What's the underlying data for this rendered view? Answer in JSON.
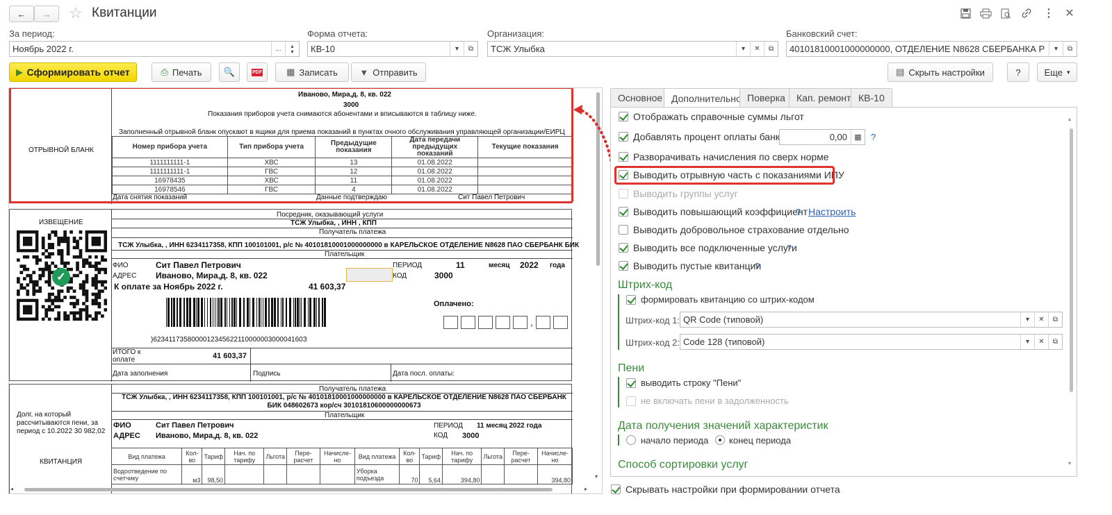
{
  "window": {
    "title": "Квитанции"
  },
  "filters": {
    "period_label": "За период:",
    "period_value": "Ноябрь 2022 г.",
    "period_dots": "...",
    "form_label": "Форма отчета:",
    "form_value": "КВ-10",
    "org_label": "Организация:",
    "org_value": "ТСЖ Улыбка",
    "bank_label": "Банковский счет:",
    "bank_value": "40101810001000000000, ОТДЕЛЕНИЕ N8628 СБЕРБАНКА Р"
  },
  "toolbar": {
    "generate": "Сформировать отчет",
    "print": "Печать",
    "save": "Записать",
    "send": "Отправить",
    "hide_settings": "Скрыть настройки",
    "help": "?",
    "more": "Еще"
  },
  "tabs": [
    "Основное",
    "Дополнительно",
    "Поверка",
    "Кап. ремонт",
    "КВ-10"
  ],
  "settings": {
    "opt1": "Отображать справочные суммы льгот",
    "opt2": "Добавлять процент оплаты банку",
    "opt2_value": "0,00",
    "opt3": "Разворачивать начисления по сверх норме",
    "opt4": "Выводить отрывную часть с показаниями ИПУ",
    "opt5": "Выводить группы услуг",
    "opt6": "Выводить повышающий коэффициент",
    "opt6_link": "Настроить",
    "opt7": "Выводить добровольное страхование отдельно",
    "opt8": "Выводить все подключенные услуги",
    "opt9": "Выводить пустые квитанции",
    "q": "?",
    "barcode_title": "Штрих-код",
    "barcode_cb": "формировать квитанцию со штрих-кодом",
    "barcode1_label": "Штрих-код 1:",
    "barcode1_value": "QR Code (типовой)",
    "barcode2_label": "Штрих-код 2:",
    "barcode2_value": "Code 128 (типовой)",
    "peni_title": "Пени",
    "peni_cb1": "выводить строку \"Пени\"",
    "peni_cb2": "не включать пени в задолженность",
    "date_title": "Дата получения значений характеристик",
    "radio1": "начало периода",
    "radio2": "конец периода",
    "sort_title": "Способ сортировки услуг",
    "bottom_cb": "Скрывать настройки при формировании отчета"
  },
  "report": {
    "tear_label": "ОТРЫВНОЙ БЛАНК",
    "address": "Иваново, Мира,д. 8, кв. 022",
    "code": "3000",
    "note1": "Показания приборов учета снимаются абонентами и вписываются в таблицу ниже.",
    "note2": "Заполненный отрывной бланк опускают в ящики для приема показаний в пунктах очного обслуживания управляющей организации/ЕИРЦ",
    "meter_headers": [
      "Номер прибора учета",
      "Тип прибора учета",
      "Предыдущие показания",
      "Дата передачи предыдущих показаний",
      "Текущие показания"
    ],
    "meters": [
      [
        "1111111111-1",
        "ХВС",
        "13",
        "01.08.2022",
        ""
      ],
      [
        "1111111111-1",
        "ГВС",
        "12",
        "01.08.2022",
        ""
      ],
      [
        "16978435",
        "ХВС",
        "11",
        "01.08.2022",
        ""
      ],
      [
        "16978546",
        "ГВС",
        "4",
        "01.08.2022",
        ""
      ]
    ],
    "date_taken": "Дата снятия показаний",
    "confirm": "Данные подтверждаю",
    "payer_short": "Сит Павел Петрович",
    "notice_label": "ИЗВЕЩЕНИЕ",
    "intermediary": "Посредник, оказывающий услуги",
    "org_line": "ТСЖ Улыбка, , ИНН , КПП",
    "recipient": "Получатель платежа",
    "recipient_line": "ТСЖ Улыбка, , ИНН 6234117358, КПП 100101001, р/с № 40101810001000000000 в КАРЕЛЬСКОЕ ОТДЕЛЕНИЕ N8628 ПАО СБЕРБАНК БИК",
    "payer_title": "Плательщик",
    "fio_label": "ФИО",
    "fio": "Сит Павел Петрович",
    "addr_label": "АДРЕС",
    "period_label": "ПЕРИОД",
    "period_num": "11",
    "month_label": "месяц",
    "year": "2022",
    "year_label": "года",
    "code_label": "КОД",
    "pay_for": "К оплате за Ноябрь 2022 г.",
    "amount": "41 603,37",
    "paid_label": "Оплачено:",
    "barcode_digits": ")623411735800001234562211000000300004160З",
    "total_label": "ИТОГО к оплате",
    "fill_date": "Дата заполнения",
    "signature": "Подпись",
    "last_pay": "Дата посл. оплаты:",
    "recipient_line2": "ТСЖ Улыбка, , ИНН 6234117358, КПП 100101001, р/с № 40101810001000000000 в КАРЕЛЬСКОЕ ОТДЕЛЕНИЕ N8628 ПАО СБЕРБАНК БИК 048602673 кор/сч 30101810600000000673",
    "debt_note": "Долг, на который рассчитываются пени, за период с 10.2022 30 982,02",
    "receipt_label": "КВИТАНЦИЯ",
    "fio_label2": "ФИО",
    "addr_label2": "АДРЕС",
    "period2": "ПЕРИОД",
    "period2_val": "11 месяц 2022 года",
    "code2": "КОД",
    "svc_headers": [
      "Вид платежа",
      "Кол-во",
      "Тариф",
      "Нач. по тарифу",
      "Льгота",
      "Пере-расчет",
      "Начисле-но",
      "Вид платежа",
      "Кол-во",
      "Тариф",
      "Нач. по тарифу",
      "Льгота",
      "Пере-расчет",
      "Начисле-но"
    ],
    "svc_row": [
      "Водоотведение по счетчику",
      "м3",
      "98,50",
      "",
      "",
      "",
      "",
      "Уборка подъезда",
      "70",
      "5,64",
      "394,80",
      "",
      "",
      "394,80"
    ]
  }
}
